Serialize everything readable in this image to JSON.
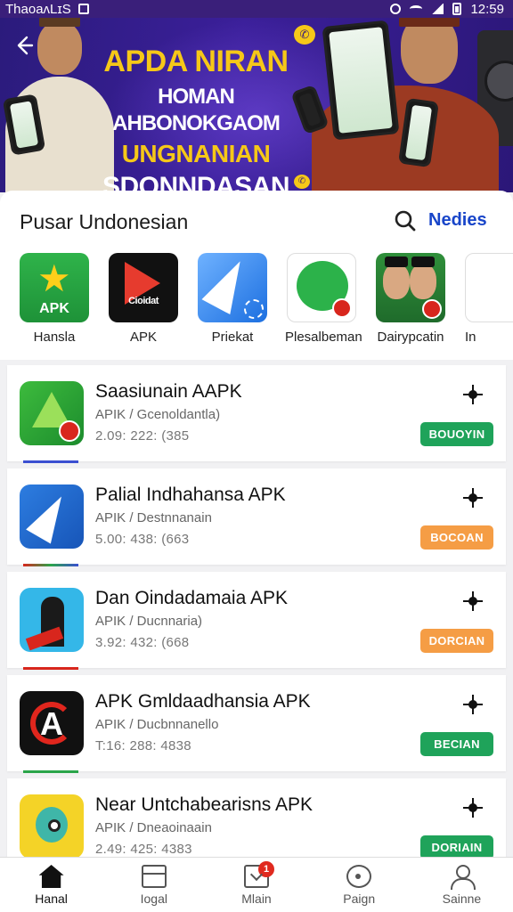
{
  "status_bar": {
    "carrier": "ThaoaʌLɪS",
    "time": "12:59"
  },
  "banner": {
    "line1": "APDA NIRAN",
    "line2": "HOMAN AHBONOKGAOM",
    "line3": "UNGNANIAN",
    "line4": "SDONNDASAN"
  },
  "section": {
    "title": "Pusar Undonesian",
    "more_label": "Nedies"
  },
  "categories": [
    {
      "label": "Hansla",
      "tile_text": "APK",
      "icon": "star-apk-icon"
    },
    {
      "label": "APK",
      "tile_text": "Cioidat",
      "icon": "play-apk-icon"
    },
    {
      "label": "Priekat",
      "icon": "arrow-app-icon"
    },
    {
      "label": "Plesalbeman",
      "icon": "chat-app-icon"
    },
    {
      "label": "Dairypcatin",
      "icon": "portrait-app-icon"
    },
    {
      "label": "In",
      "icon": "app-icon"
    }
  ],
  "apps": [
    {
      "title": "Saasiunain AAPK",
      "subtitle": "APIK / Gcenoldantla)",
      "meta": "2.09: 222: (385",
      "button": "BOUOYIN",
      "button_color": "#1fa35a",
      "accent": "#3b4fd1",
      "icon": "triangle-app-icon"
    },
    {
      "title": "Palial Indhahansa APK",
      "subtitle": "APIK / Destnnanain",
      "meta": "5.00: 438: (663",
      "button": "BOCOAN",
      "button_color": "#f59d45",
      "accent": "#2aa54a",
      "icon": "fin-app-icon"
    },
    {
      "title": "Dan Oindadamaia APK",
      "subtitle": "APIK / Ducnnaria)",
      "meta": "3.92: 432: (668",
      "button": "DORCIAN",
      "button_color": "#f59d45",
      "accent": "#d8261d",
      "icon": "figure-app-icon"
    },
    {
      "title": "APK Gmldaadhansia APK",
      "subtitle": "APIK / Ducbnnanello",
      "meta": "T:16: 288: 4838",
      "button": "BECIAN",
      "button_color": "#1fa35a",
      "accent": "#2aa54a",
      "icon": "letter-a-app-icon"
    },
    {
      "title": "Near Untchabearisns APK",
      "subtitle": "APIK / Dneaoinaain",
      "meta": "2.49: 425: 4383",
      "button": "DORIAIN",
      "button_color": "#1fa35a",
      "accent": "#2aa54a",
      "icon": "robot-app-icon"
    }
  ],
  "bottom_nav": [
    {
      "label": "Hanal",
      "icon": "home-icon",
      "active": true
    },
    {
      "label": "Iogal",
      "icon": "card-icon"
    },
    {
      "label": "Mlain",
      "icon": "download-icon",
      "badge": "1"
    },
    {
      "label": "Paign",
      "icon": "circle-icon"
    },
    {
      "label": "Sainne",
      "icon": "user-icon"
    }
  ]
}
